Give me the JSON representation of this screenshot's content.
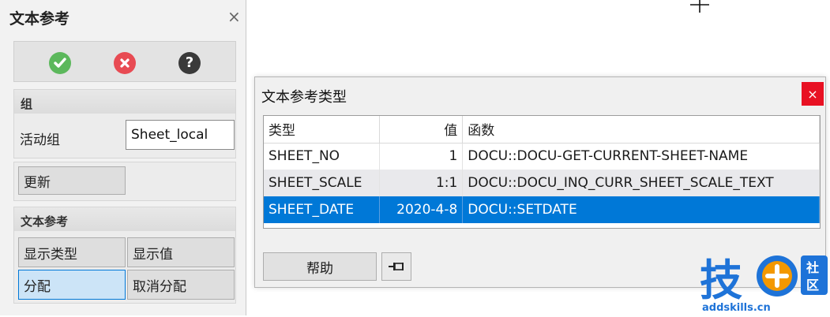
{
  "panel": {
    "title": "文本参考",
    "close_glyph": "×",
    "icons": {
      "ok": "check-icon",
      "cancel": "x-icon",
      "help": "question-icon"
    },
    "help_glyph": "?",
    "group": {
      "header": "组",
      "active_group_label": "活动组",
      "active_group_value": "Sheet_local"
    },
    "update_button": "更新",
    "text_ref": {
      "header": "文本参考",
      "show_type": "显示类型",
      "show_value": "显示值",
      "assign": "分配",
      "unassign": "取消分配"
    }
  },
  "dialog": {
    "title": "文本参考类型",
    "close_glyph": "×",
    "columns": {
      "type": "类型",
      "value": "值",
      "function": "函数"
    },
    "rows": [
      {
        "type": "SHEET_NO",
        "value": "1",
        "function": "DOCU::DOCU-GET-CURRENT-SHEET-NAME"
      },
      {
        "type": "SHEET_SCALE",
        "value": "1:1",
        "function": "DOCU::DOCU_INQ_CURR_SHEET_SCALE_TEXT"
      },
      {
        "type": "SHEET_DATE",
        "value": "2020-4-8",
        "function": "DOCU::SETDATE"
      }
    ],
    "selected_row": 2,
    "help_button": "帮助",
    "pin_icon": "pin-icon"
  },
  "watermark": {
    "logo_text": "技",
    "side_text": "社区",
    "url": "addskills.cn"
  },
  "colors": {
    "accent": "#0078d7",
    "ok": "#5cb85c",
    "cancel": "#e84b53",
    "close_red": "#e81123",
    "brand_blue": "#1e73d8",
    "brand_orange": "#f39800"
  }
}
